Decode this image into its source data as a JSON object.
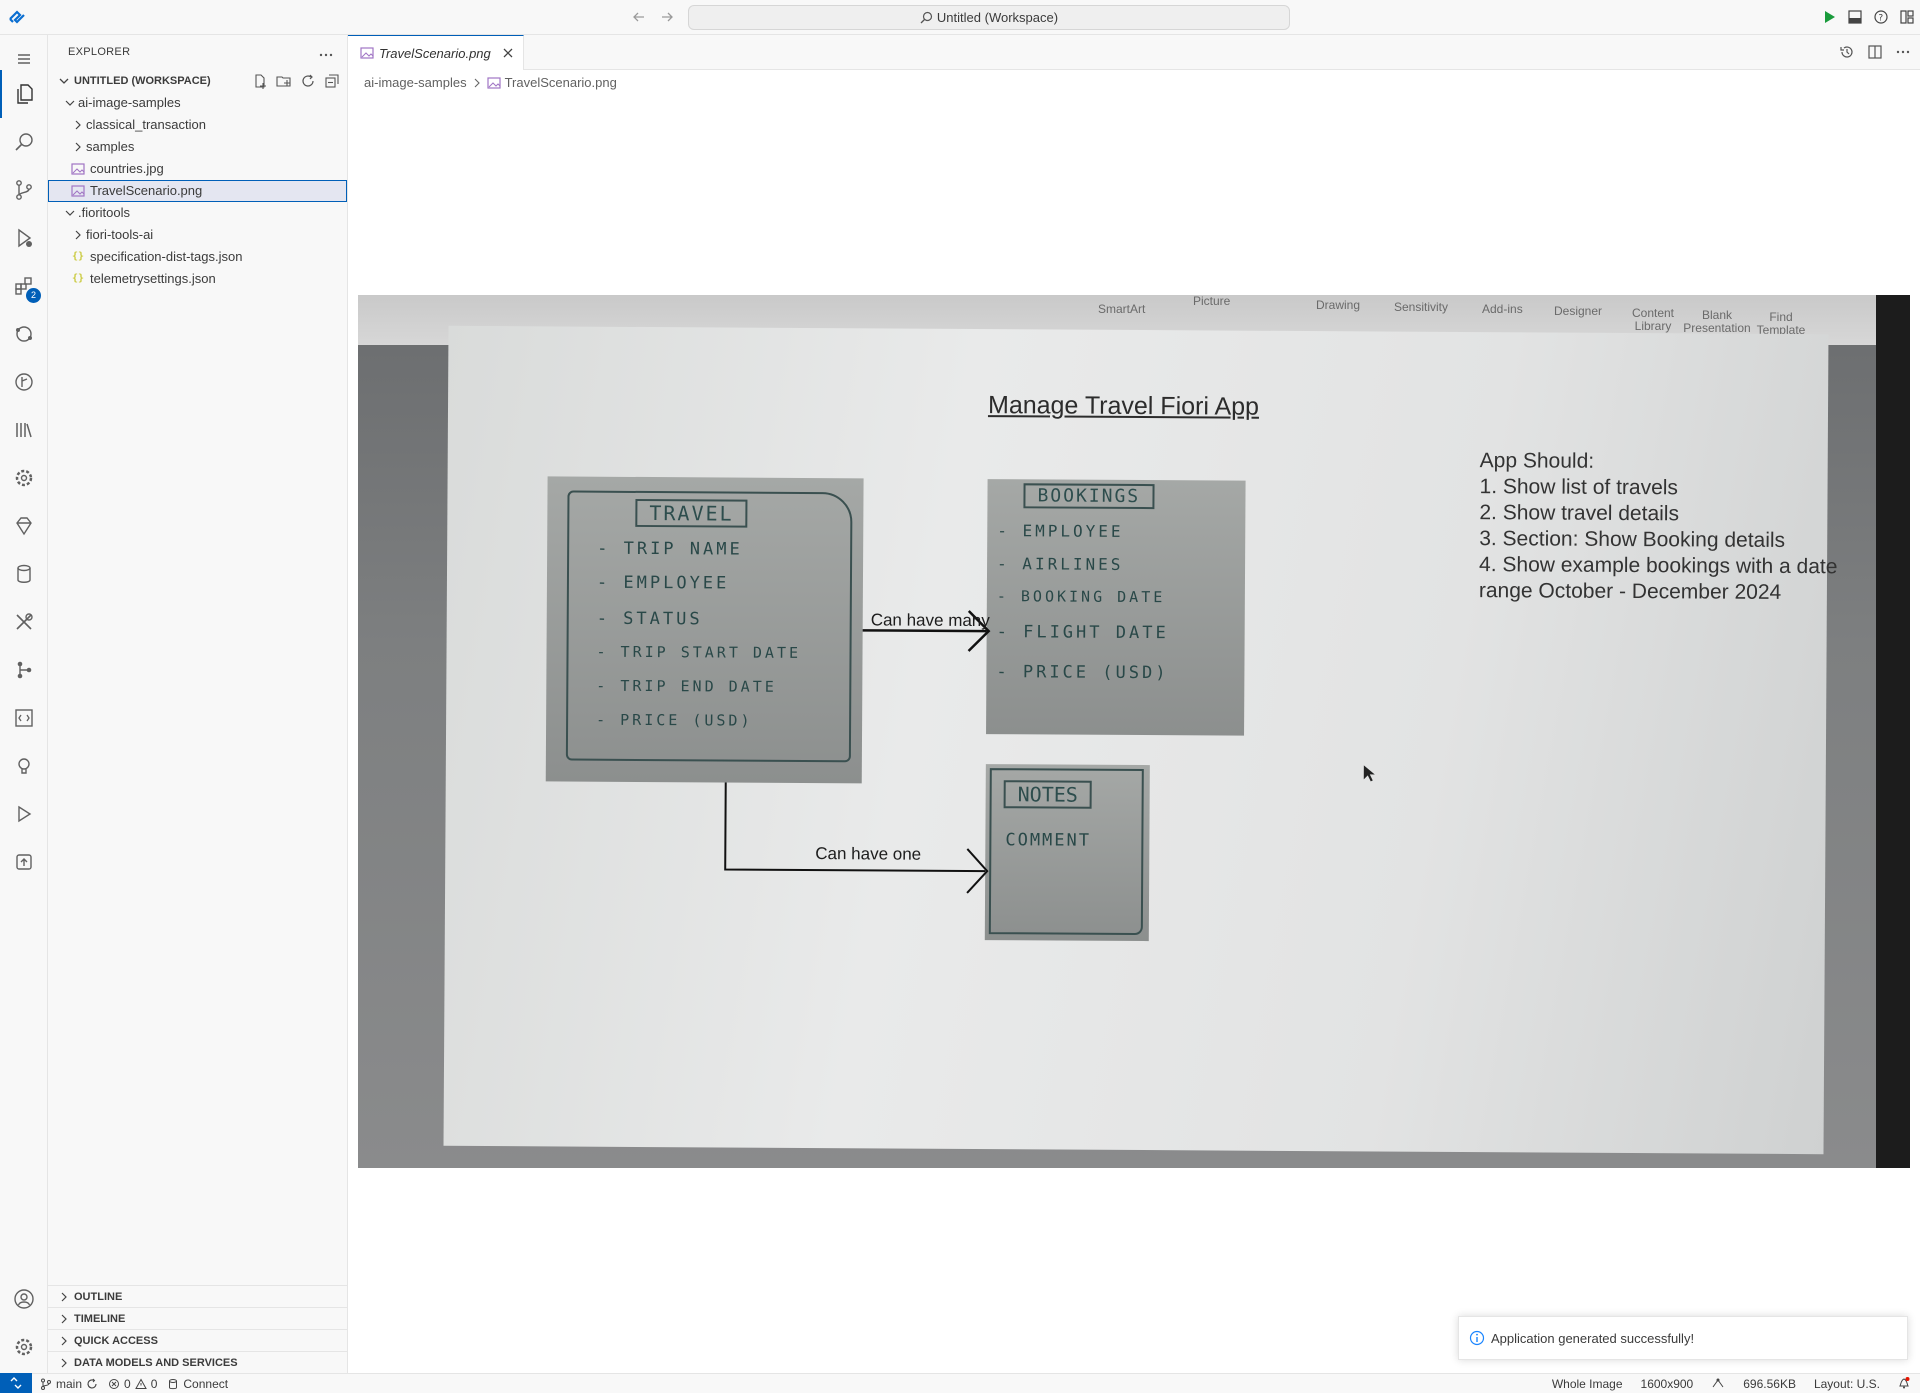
{
  "window": {
    "title": "Untitled (Workspace)"
  },
  "activity_bar": {
    "items": [
      "explorer-icon",
      "search-icon",
      "source-control-icon",
      "run-debug-icon",
      "extensions-icon",
      "remote-icon",
      "git-graph-icon",
      "library-icon",
      "settings-cog-icon",
      "gem-icon",
      "database-icon",
      "tools-icon",
      "workflow-icon",
      "code-snippet-icon",
      "bulb-icon",
      "play-icon",
      "deploy-icon",
      "account-icon",
      "manage-gear-icon"
    ],
    "extensions_badge": "2"
  },
  "sidebar": {
    "title": "EXPLORER",
    "workspace": "UNTITLED (WORKSPACE)",
    "tree": [
      {
        "label": "ai-image-samples",
        "type": "folder-open"
      },
      {
        "label": "classical_transaction",
        "type": "folder"
      },
      {
        "label": "samples",
        "type": "folder"
      },
      {
        "label": "countries.jpg",
        "type": "image"
      },
      {
        "label": "TravelScenario.png",
        "type": "image"
      },
      {
        "label": ".fioritools",
        "type": "folder-open"
      },
      {
        "label": "fiori-tools-ai",
        "type": "folder"
      },
      {
        "label": "specification-dist-tags.json",
        "type": "json"
      },
      {
        "label": "telemetrysettings.json",
        "type": "json"
      }
    ],
    "bottom_sections": [
      "OUTLINE",
      "TIMELINE",
      "QUICK ACCESS",
      "DATA MODELS AND SERVICES"
    ]
  },
  "editor": {
    "tab_label": "TravelScenario.png",
    "breadcrumb": [
      "ai-image-samples",
      "TravelScenario.png"
    ]
  },
  "image": {
    "ribbon": [
      "SmartArt",
      "Picture",
      "Drawing",
      "Sensitivity",
      "Add-ins",
      "Designer",
      "Content Library",
      "Blank Presentation",
      "Find Template"
    ],
    "slide_title": "Manage Travel Fiori App",
    "travel_box": {
      "title": "TRAVEL",
      "fields": [
        "- TRIP NAME",
        "- EMPLOYEE",
        "- STATUS",
        "- TRIP START DATE",
        "- TRIP END DATE",
        "- PRICE (USD)"
      ]
    },
    "bookings_box": {
      "title": "BOOKINGS",
      "fields": [
        "- EMPLOYEE",
        "- AIRLINES",
        "- BOOKING DATE",
        "- FLIGHT DATE",
        "- PRICE (USD)"
      ]
    },
    "notes_box": {
      "title": "NOTES",
      "fields": [
        "COMMENT"
      ]
    },
    "relation_many": "Can have many",
    "relation_one": "Can have one",
    "requirements": [
      "App Should:",
      "1. Show list of travels",
      "2. Show travel details",
      "3. Section: Show Booking details",
      "4. Show example bookings with a date",
      "range October - December 2024"
    ]
  },
  "notification": {
    "message": "Application generated successfully!"
  },
  "status_bar": {
    "branch": "main",
    "errors": "0",
    "warnings": "0",
    "connect": "Connect",
    "zoom": "Whole Image",
    "dimensions": "1600x900",
    "size": "696.56KB",
    "layout": "Layout: U.S."
  },
  "colors": {
    "accent": "#005fb8",
    "sidebar_bg": "#f8f8f8",
    "selection": "#e4e6f1"
  }
}
